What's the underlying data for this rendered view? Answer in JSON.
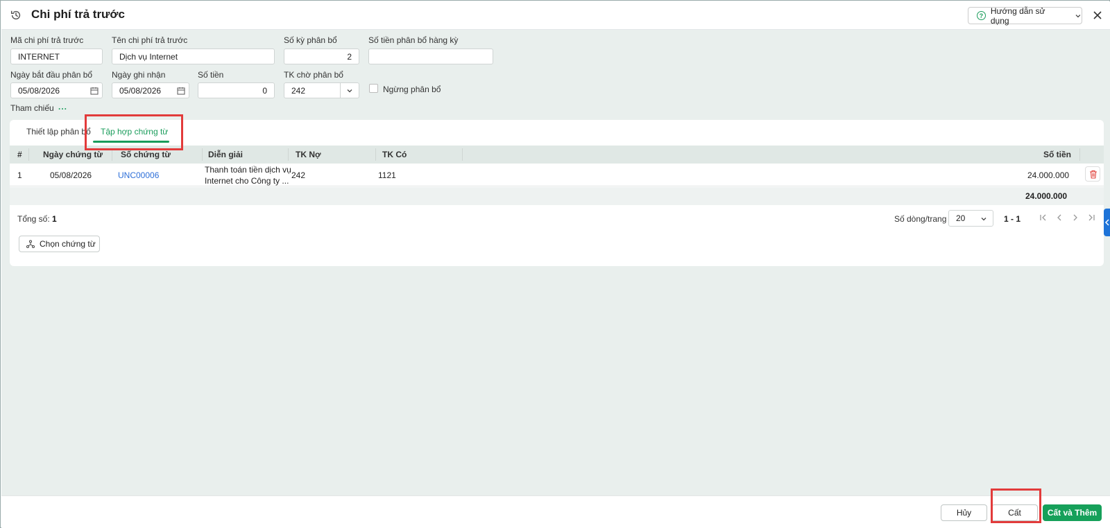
{
  "header": {
    "title": "Chi phí trả trước",
    "help_label": "Hướng dẫn sử dụng"
  },
  "form": {
    "code_label": "Mã chi phí trả trước",
    "code_value": "INTERNET",
    "name_label": "Tên chi phí trả trước",
    "name_value": "Dịch vụ Internet",
    "periods_label": "Số kỳ phân bổ",
    "periods_value": "2",
    "period_amount_label": "Số tiền phân bổ hàng kỳ",
    "period_amount_value": "",
    "start_date_label": "Ngày bắt đầu phân bổ",
    "start_date_value": "05/08/2026",
    "record_date_label": "Ngày ghi nhận",
    "record_date_value": "05/08/2026",
    "amount_label": "Số tiền",
    "amount_value": "0",
    "account_label": "TK chờ phân bổ",
    "account_value": "242",
    "stop_label": "Ngừng phân bổ",
    "ref_label": "Tham chiếu",
    "ref_dots": "..."
  },
  "tabs": [
    {
      "label": "Thiết lập phân bổ"
    },
    {
      "label": "Tập hợp chứng từ"
    }
  ],
  "table": {
    "headers": [
      "#",
      "Ngày chứng từ",
      "Số chứng từ",
      "Diễn giải",
      "TK Nợ",
      "TK Có",
      "Số tiền"
    ],
    "rows": [
      {
        "index": "1",
        "date": "05/08/2026",
        "doc_no": "UNC00006",
        "desc_line1": "Thanh toán tiền dịch vụ",
        "desc_line2": "Internet cho Công ty ...",
        "debit": "242",
        "credit": "1121",
        "amount": "24.000.000"
      }
    ],
    "total_amount": "24.000.000"
  },
  "pagination": {
    "total_label": "Tổng số:",
    "total_value": "1",
    "rows_per_page_label": "Số dòng/trang",
    "rows_per_page_value": "20",
    "range": "1 - 1"
  },
  "choose_button": "Chọn chứng từ",
  "footer": {
    "cancel": "Hủy",
    "save": "Cất",
    "save_add": "Cất và Thêm"
  },
  "colors": {
    "accent": "#1a9c5b",
    "link": "#2d6fd8",
    "highlight": "#e23b3b"
  }
}
